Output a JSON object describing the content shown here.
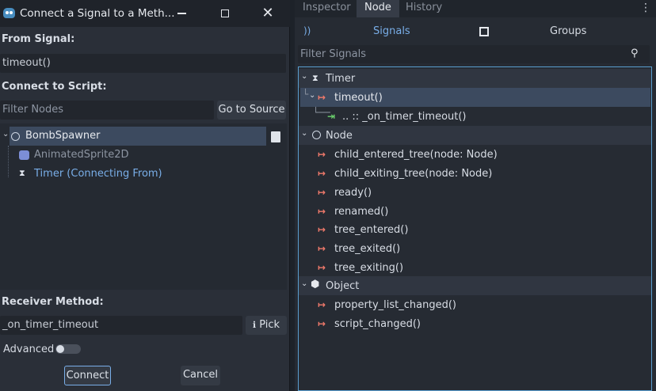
{
  "dialog": {
    "title": "Connect a Signal to a Meth...",
    "from_signal_label": "From Signal:",
    "from_signal_value": "timeout()",
    "connect_to_script_label": "Connect to Script:",
    "filter_nodes_placeholder": "Filter Nodes",
    "go_to_source_label": "Go to Source",
    "tree": [
      {
        "label": "BombSpawner",
        "icon": "node-circle-icon"
      },
      {
        "label": "AnimatedSprite2D",
        "icon": "animated-sprite-icon"
      },
      {
        "label": "Timer (Connecting From)",
        "icon": "hourglass-icon"
      }
    ],
    "receiver_method_label": "Receiver Method:",
    "receiver_method_value": "_on_timer_timeout",
    "pick_label": "Pick",
    "advanced_label": "Advanced",
    "advanced_enabled": false,
    "connect_label": "Connect",
    "cancel_label": "Cancel"
  },
  "panel": {
    "tabs": [
      "Inspector",
      "Node",
      "History"
    ],
    "active_tab": "Node",
    "subtabs": [
      "Signals",
      "Groups"
    ],
    "filter_placeholder": "Filter Signals",
    "categories": [
      {
        "label": "Timer",
        "icon": "hourglass-icon",
        "signals": [
          {
            "label": "timeout()",
            "selected": true,
            "connections": [
              ".. :: _on_timer_timeout()"
            ]
          }
        ]
      },
      {
        "label": "Node",
        "icon": "node-circle-icon",
        "signals": [
          {
            "label": "child_entered_tree(node: Node)"
          },
          {
            "label": "child_exiting_tree(node: Node)"
          },
          {
            "label": "ready()"
          },
          {
            "label": "renamed()"
          },
          {
            "label": "tree_entered()"
          },
          {
            "label": "tree_exited()"
          },
          {
            "label": "tree_exiting()"
          }
        ]
      },
      {
        "label": "Object",
        "icon": "object-cube-icon",
        "signals": [
          {
            "label": "property_list_changed()"
          },
          {
            "label": "script_changed()"
          }
        ]
      }
    ]
  },
  "colors": {
    "accent": "#79aee8",
    "signal_icon": "#f07a6b",
    "connection_icon": "#6cd36e",
    "selection": "#3c4a5f"
  }
}
